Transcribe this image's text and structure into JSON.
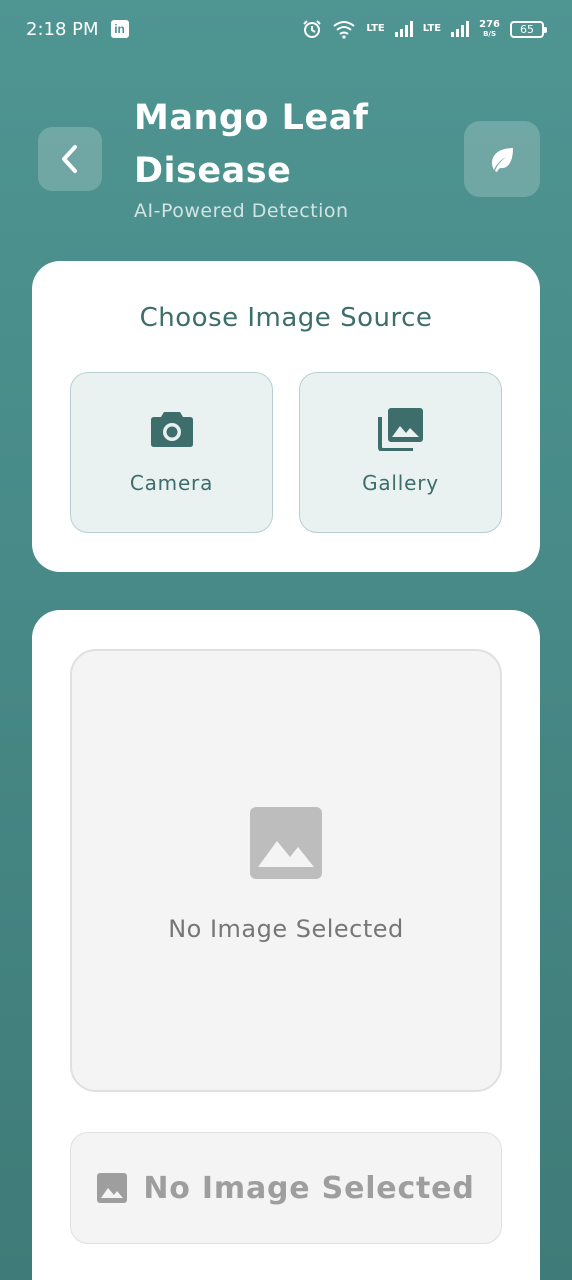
{
  "status_bar": {
    "time": "2:18 PM",
    "app_badge": "in",
    "net1": "LTE",
    "net2": "LTE",
    "speed_value": "276",
    "speed_unit": "B/S",
    "battery": "65"
  },
  "header": {
    "title": "Mango Leaf Disease",
    "subtitle": "AI-Powered Detection",
    "back_icon": "chevron-left-icon",
    "leaf_icon": "leaf-icon"
  },
  "source": {
    "title": "Choose Image Source",
    "camera_label": "Camera",
    "gallery_label": "Gallery"
  },
  "preview": {
    "placeholder_text": "No Image Selected",
    "button_label": "No Image Selected"
  },
  "colors": {
    "background_top": "#4f9592",
    "background_bottom": "#3f7b78",
    "accent_text": "#3d6e6b",
    "source_button_bg": "#e9f1f1",
    "disabled_text": "#9e9e9e"
  }
}
